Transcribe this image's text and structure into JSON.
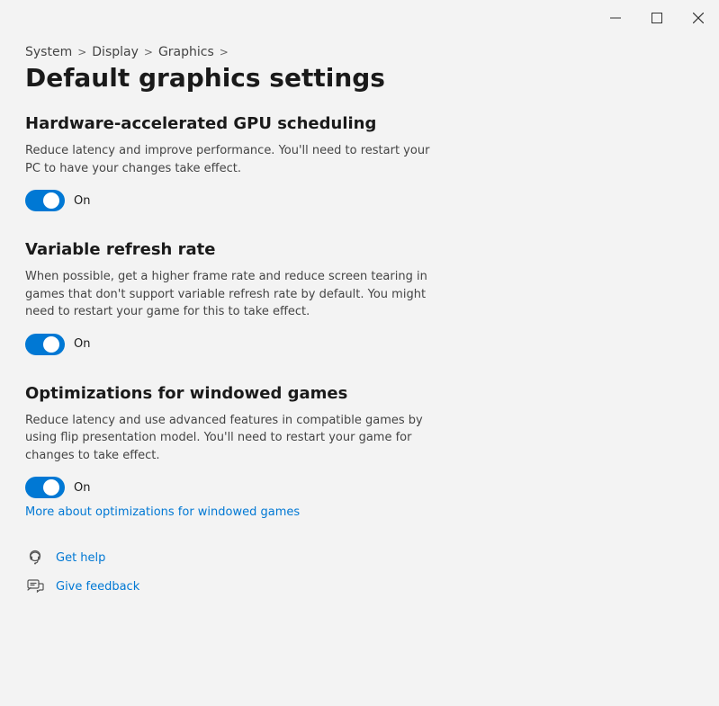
{
  "window": {
    "title": "Default graphics settings"
  },
  "titlebar": {
    "minimize_label": "Minimize",
    "maximize_label": "Maximize",
    "close_label": "Close"
  },
  "breadcrumb": {
    "items": [
      {
        "label": "System",
        "id": "system"
      },
      {
        "label": "Display",
        "id": "display"
      },
      {
        "label": "Graphics",
        "id": "graphics"
      }
    ],
    "separator": ">",
    "current": "Default graphics settings"
  },
  "sections": [
    {
      "id": "hardware-gpu",
      "title": "Hardware-accelerated GPU scheduling",
      "description": "Reduce latency and improve performance. You'll need to restart your PC to have your changes take effect.",
      "toggle_state": true,
      "toggle_on_label": "On"
    },
    {
      "id": "variable-refresh",
      "title": "Variable refresh rate",
      "description": "When possible, get a higher frame rate and reduce screen tearing in games that don't support variable refresh rate by default. You might need to restart your game for this to take effect.",
      "toggle_state": true,
      "toggle_on_label": "On"
    },
    {
      "id": "windowed-games",
      "title": "Optimizations for windowed games",
      "description": "Reduce latency and use advanced features in compatible games by using flip presentation model. You'll need to restart your game for changes to take effect.",
      "toggle_state": true,
      "toggle_on_label": "On",
      "link": {
        "text": "More about optimizations for windowed games",
        "url": "#"
      }
    }
  ],
  "footer": {
    "get_help": "Get help",
    "give_feedback": "Give feedback"
  }
}
